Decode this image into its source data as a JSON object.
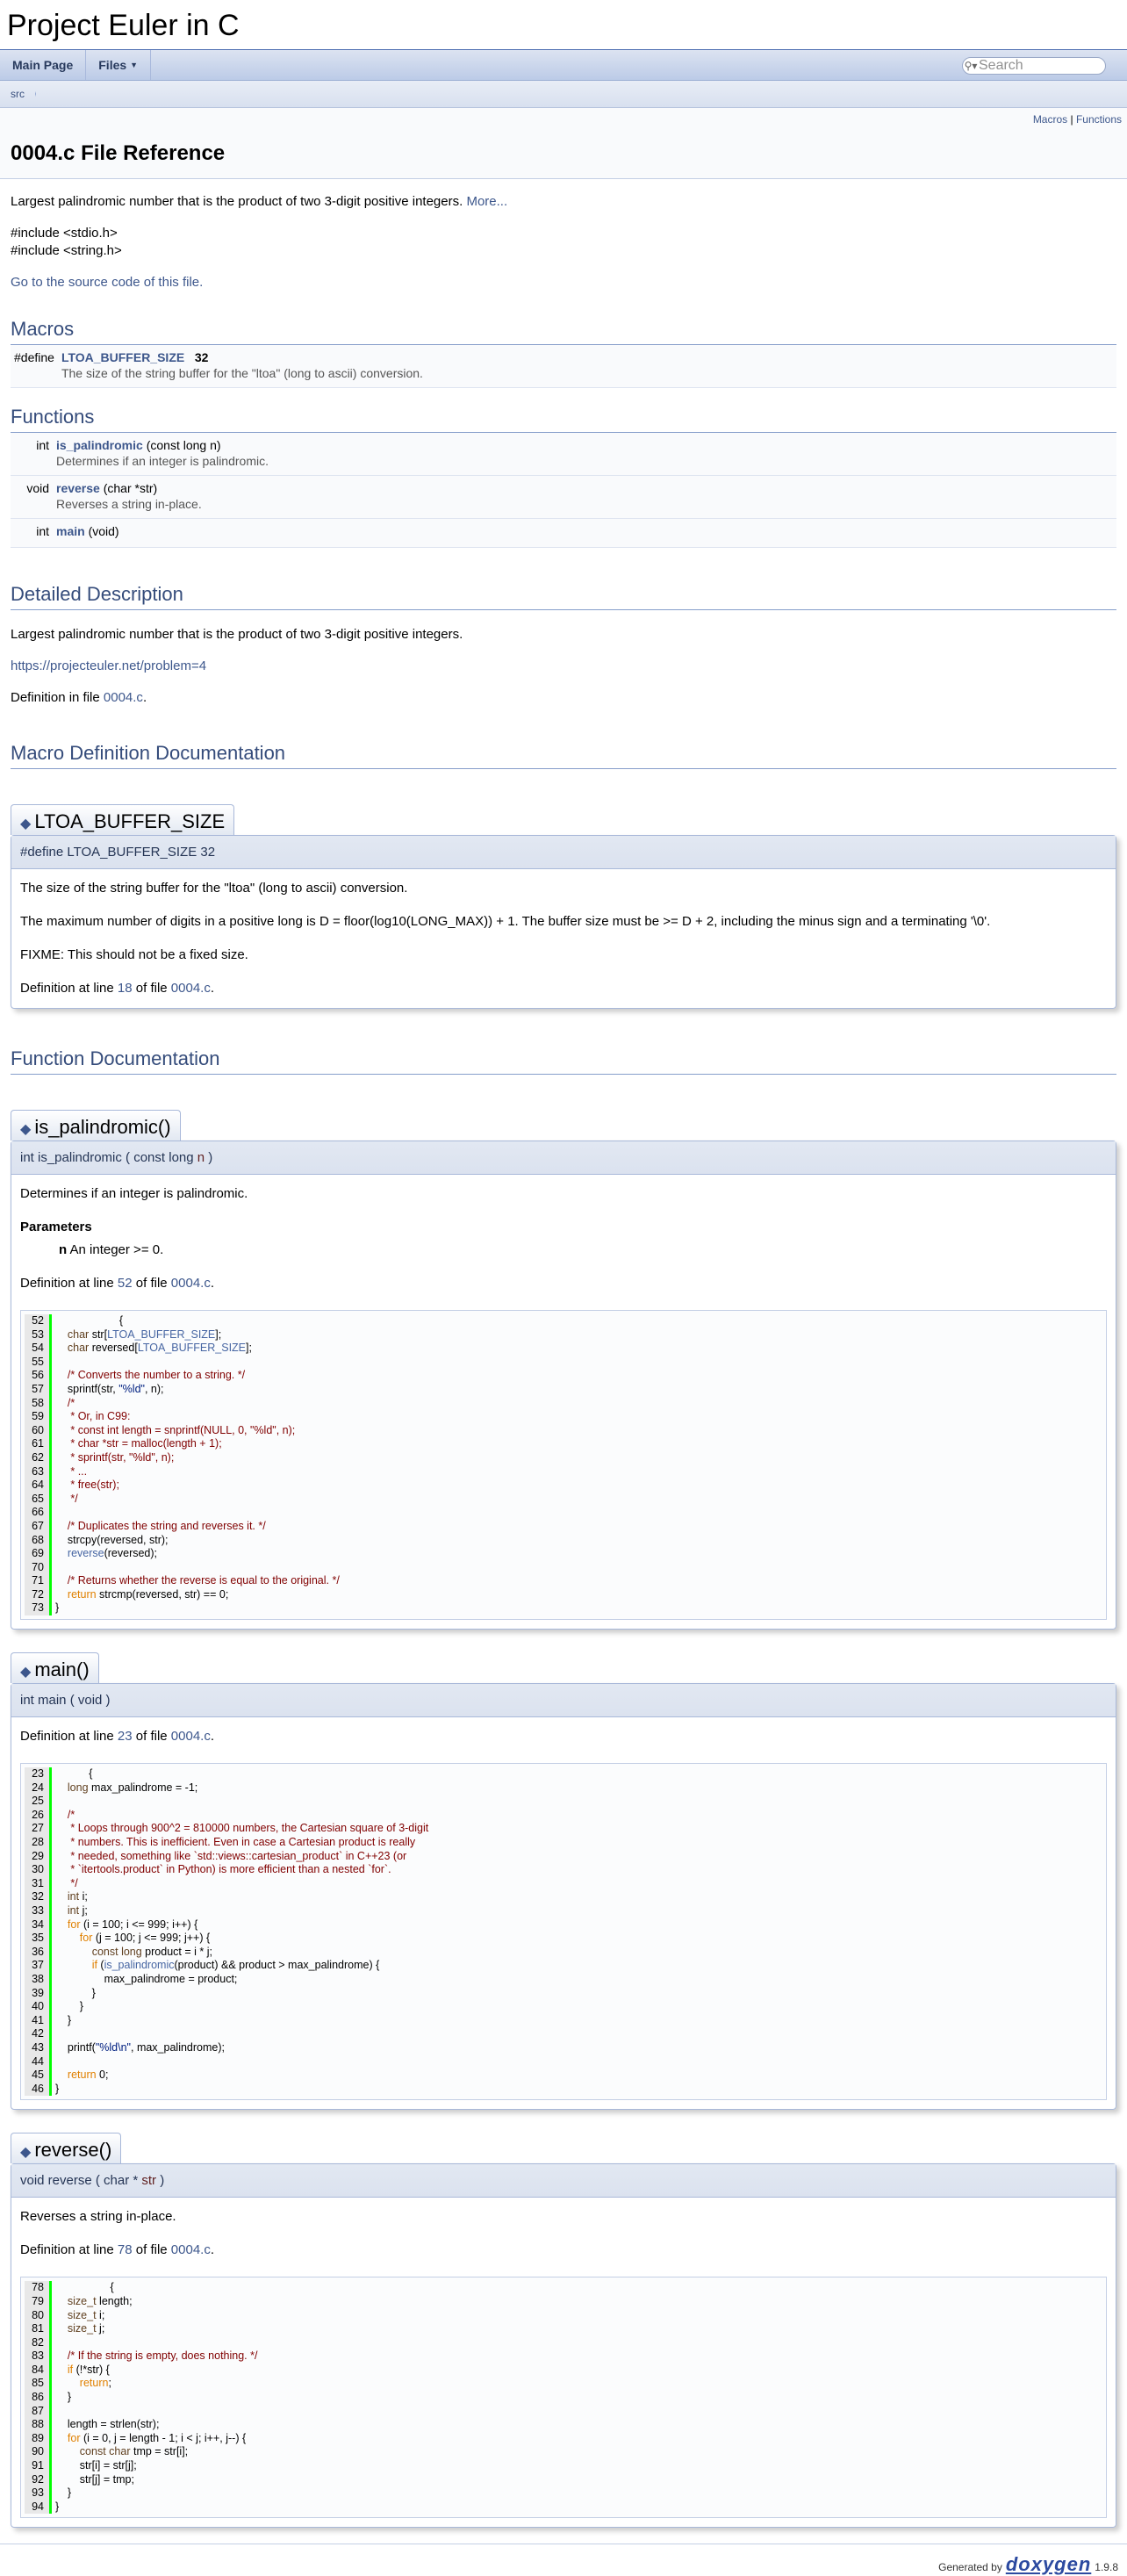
{
  "project_name": "Project Euler in C",
  "nav": {
    "main_page": "Main Page",
    "files": "Files",
    "search_placeholder": "Search"
  },
  "breadcrumb": "src",
  "header": {
    "summary_macros": "Macros",
    "summary_sep": "|",
    "summary_functions": "Functions",
    "title": "0004.c File Reference"
  },
  "brief": {
    "text": "Largest palindromic number that is the product of two 3-digit positive integers.",
    "more": "More..."
  },
  "includes": [
    "#include <stdio.h>",
    "#include <string.h>"
  ],
  "source_link": "Go to the source code of this file.",
  "macros_section": {
    "heading": "Macros",
    "items": [
      {
        "left": "#define",
        "name": "LTOA_BUFFER_SIZE",
        "value": "32",
        "desc": "The size of the string buffer for the \"ltoa\" (long to ascii) conversion."
      }
    ]
  },
  "functions_section": {
    "heading": "Functions",
    "items": [
      {
        "ret": "int",
        "name": "is_palindromic",
        "args": "(const long n)",
        "desc": "Determines if an integer is palindromic."
      },
      {
        "ret": "void",
        "name": "reverse",
        "args": "(char *str)",
        "desc": "Reverses a string in-place."
      },
      {
        "ret": "int",
        "name": "main",
        "args": "(void)",
        "desc": ""
      }
    ]
  },
  "detailed": {
    "heading": "Detailed Description",
    "text": "Largest palindromic number that is the product of two 3-digit positive integers.",
    "link": "https://projecteuler.net/problem=4",
    "def_prefix": "Definition in file",
    "def_file": "0004.c",
    "def_suffix": "."
  },
  "macro_doc": {
    "heading": "Macro Definition Documentation",
    "title": "LTOA_BUFFER_SIZE",
    "proto": "#define LTOA_BUFFER_SIZE   32",
    "p1": "The size of the string buffer for the \"ltoa\" (long to ascii) conversion.",
    "p2": "The maximum number of digits in a positive long is D = floor(log10(LONG_MAX)) + 1. The buffer size must be >= D + 2, including the minus sign and a terminating '\\0'.",
    "p3": "FIXME: This should not be a fixed size.",
    "def_prefix": "Definition at line",
    "def_line": "18",
    "def_mid": "of file",
    "def_file": "0004.c",
    "def_suffix": "."
  },
  "function_doc": {
    "heading": "Function Documentation",
    "is_palindromic": {
      "title": "is_palindromic()",
      "proto_pre": "int is_palindromic ( const long ",
      "proto_param": "n",
      "proto_post": " )",
      "brief": "Determines if an integer is palindromic.",
      "params_label": "Parameters",
      "param_name": "n",
      "param_desc": "An integer >= 0.",
      "def_prefix": "Definition at line",
      "def_line": "52",
      "def_mid": "of file",
      "def_file": "0004.c",
      "def_suffix": "."
    },
    "main": {
      "title": "main()",
      "proto": "int main ( void   )",
      "def_prefix": "Definition at line",
      "def_line": "23",
      "def_mid": "of file",
      "def_file": "0004.c",
      "def_suffix": "."
    },
    "reverse": {
      "title": "reverse()",
      "proto_pre": "void reverse ( char * ",
      "proto_param": "str",
      "proto_post": " )",
      "brief": "Reverses a string in-place.",
      "def_prefix": "Definition at line",
      "def_line": "78",
      "def_mid": "of file",
      "def_file": "0004.c",
      "def_suffix": "."
    }
  },
  "footer": {
    "generated_by": "Generated by",
    "logo": "doxygen",
    "version": "1.9.8"
  }
}
